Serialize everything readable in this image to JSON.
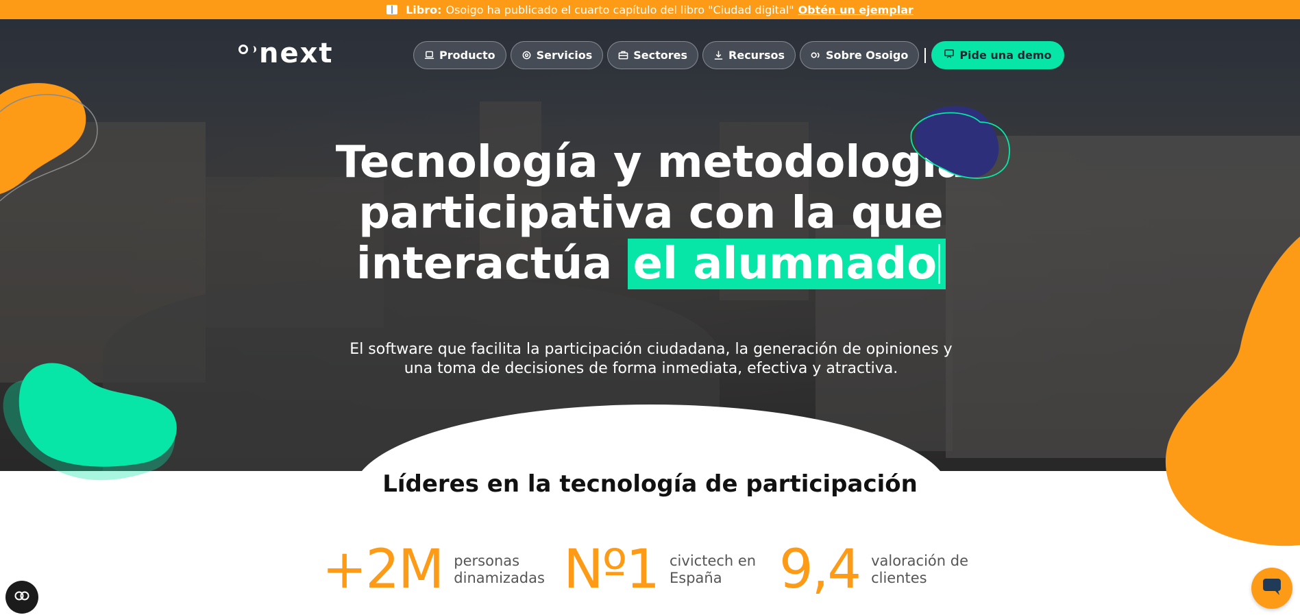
{
  "announcement": {
    "icon": "book-icon",
    "prefix": "Libro:",
    "text": "Osoigo ha publicado el cuarto capítulo del libro \"Ciudad digital\"",
    "link": "Obtén un ejemplar"
  },
  "header": {
    "logo_text": "next",
    "nav": [
      {
        "label": "Producto",
        "icon": "laptop-icon"
      },
      {
        "label": "Servicios",
        "icon": "gear-icon"
      },
      {
        "label": "Sectores",
        "icon": "briefcase-icon"
      },
      {
        "label": "Recursos",
        "icon": "download-icon"
      },
      {
        "label": "Sobre Osoigo",
        "icon": "osoigo-logo-icon"
      }
    ],
    "cta": {
      "label": "Pide una demo",
      "icon": "presentation-icon"
    }
  },
  "hero": {
    "title_line1": "Tecnología y metodología",
    "title_line2": "participativa con la que",
    "title_line3": "interactúa",
    "title_highlight": "el alumnado",
    "subtitle_line1": "El software que facilita la participación ciudadana, la generación de opiniones y",
    "subtitle_line2": "una toma de decisiones de forma inmediata, efectiva y atractiva."
  },
  "section": {
    "title": "Líderes en la tecnología de participación",
    "stats": [
      {
        "value": "+2M",
        "label_line1": "personas",
        "label_line2": "dinamizadas"
      },
      {
        "value": "Nº1",
        "label_line1": "civictech en",
        "label_line2": "España"
      },
      {
        "value": "9,4",
        "label_line1": "valoración de",
        "label_line2": "clientes"
      }
    ]
  },
  "colors": {
    "accent_orange": "#fd9a16",
    "accent_green": "#07e6a6",
    "navy_blob": "#2e2f7a"
  },
  "widgets": {
    "cookie_icon": "cookie-settings-icon",
    "chat_icon": "chat-icon"
  }
}
